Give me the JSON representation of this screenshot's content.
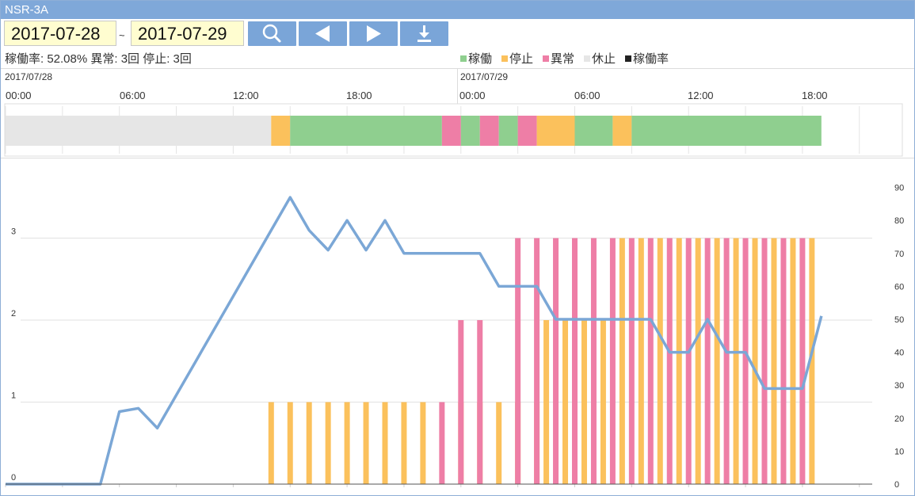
{
  "window": {
    "title": "NSR-3A"
  },
  "toolbar": {
    "start_date": "2017-07-28",
    "separator": "~",
    "end_date": "2017-07-29",
    "buttons": [
      {
        "name": "search-button",
        "icon": "search-icon"
      },
      {
        "name": "prev-button",
        "icon": "triangle-left-icon"
      },
      {
        "name": "next-button",
        "icon": "triangle-right-icon"
      },
      {
        "name": "download-button",
        "icon": "download-icon"
      }
    ]
  },
  "summary": {
    "text": "稼働率: 52.08% 異常: 3回 停止: 3回"
  },
  "legend": [
    {
      "label": "稼働",
      "color": "#8fcf8f"
    },
    {
      "label": "停止",
      "color": "#fbc15c"
    },
    {
      "label": "異常",
      "color": "#ee7ea6"
    },
    {
      "label": "休止",
      "color": "#e6e6e6"
    },
    {
      "label": "稼働率",
      "color": "#222222"
    }
  ],
  "time_axis": {
    "dates": [
      "2017/07/28",
      "2017/07/29"
    ],
    "ticks": [
      "00:00",
      "06:00",
      "12:00",
      "18:00",
      "00:00",
      "06:00",
      "12:00",
      "18:00"
    ]
  },
  "timeline": {
    "segments": [
      {
        "state": "休止",
        "start_hour": 0.0,
        "end_hour": 14.0
      },
      {
        "state": "停止",
        "start_hour": 14.0,
        "end_hour": 15.0
      },
      {
        "state": "稼働",
        "start_hour": 15.0,
        "end_hour": 23.0
      },
      {
        "state": "異常",
        "start_hour": 23.0,
        "end_hour": 24.0
      },
      {
        "state": "稼働",
        "start_hour": 24.0,
        "end_hour": 25.0
      },
      {
        "state": "異常",
        "start_hour": 25.0,
        "end_hour": 26.0
      },
      {
        "state": "稼働",
        "start_hour": 26.0,
        "end_hour": 27.0
      },
      {
        "state": "異常",
        "start_hour": 27.0,
        "end_hour": 28.0
      },
      {
        "state": "停止",
        "start_hour": 28.0,
        "end_hour": 30.0
      },
      {
        "state": "稼働",
        "start_hour": 30.0,
        "end_hour": 32.0
      },
      {
        "state": "停止",
        "start_hour": 32.0,
        "end_hour": 33.0
      },
      {
        "state": "稼働",
        "start_hour": 33.0,
        "end_hour": 43.0
      }
    ]
  },
  "chart_data": {
    "type": "bar",
    "x_unit": "hours since 2017/07/28 00:00",
    "y_left_ticks": [
      "0",
      "1",
      "2",
      "3"
    ],
    "y_right_ticks": [
      "0",
      "10",
      "20",
      "30",
      "40",
      "50",
      "60",
      "70",
      "80",
      "90"
    ],
    "ylim_left": [
      0,
      3.3
    ],
    "ylim_right": [
      0,
      90
    ],
    "grid": true,
    "series": [
      {
        "name": "停止",
        "kind": "bar",
        "color": "#fbc15c",
        "points": [
          [
            14,
            1
          ],
          [
            15,
            1
          ],
          [
            16,
            1
          ],
          [
            17,
            1
          ],
          [
            18,
            1
          ],
          [
            19,
            1
          ],
          [
            20,
            1
          ],
          [
            21,
            1
          ],
          [
            22,
            1
          ],
          [
            24,
            1
          ],
          [
            25,
            1
          ],
          [
            26,
            1
          ],
          [
            27,
            1
          ],
          [
            28,
            1
          ],
          [
            28.5,
            2
          ],
          [
            29.5,
            2
          ],
          [
            30.5,
            2
          ],
          [
            31.5,
            2
          ],
          [
            32.5,
            3
          ],
          [
            33.5,
            3
          ],
          [
            34.5,
            3
          ],
          [
            35.5,
            3
          ],
          [
            36.5,
            3
          ],
          [
            37.5,
            3
          ],
          [
            38.5,
            3
          ],
          [
            39.5,
            3
          ],
          [
            40.5,
            3
          ],
          [
            41.5,
            3
          ],
          [
            42.5,
            3
          ]
        ]
      },
      {
        "name": "異常",
        "kind": "bar",
        "color": "#ee7ea6",
        "points": [
          [
            23,
            1
          ],
          [
            24,
            2
          ],
          [
            25,
            2
          ],
          [
            27,
            3
          ],
          [
            28,
            3
          ],
          [
            29,
            3
          ],
          [
            30,
            3
          ],
          [
            31,
            3
          ],
          [
            32,
            3
          ],
          [
            33,
            3
          ],
          [
            34,
            3
          ],
          [
            35,
            3
          ],
          [
            36,
            3
          ],
          [
            37,
            3
          ],
          [
            38,
            3
          ],
          [
            39,
            3
          ],
          [
            40,
            3
          ],
          [
            41,
            3
          ],
          [
            42,
            3
          ]
        ]
      },
      {
        "name": "稼働率",
        "kind": "line",
        "color": "#7ba7d6",
        "axis": "right",
        "points": [
          [
            0,
            0
          ],
          [
            1,
            0
          ],
          [
            2,
            0
          ],
          [
            3,
            0
          ],
          [
            4,
            0
          ],
          [
            5,
            0
          ],
          [
            6,
            22
          ],
          [
            7,
            23
          ],
          [
            8,
            17
          ],
          [
            9,
            27
          ],
          [
            10,
            37
          ],
          [
            11,
            47
          ],
          [
            12,
            57
          ],
          [
            13,
            67
          ],
          [
            14,
            77
          ],
          [
            15,
            87
          ],
          [
            16,
            77
          ],
          [
            17,
            71
          ],
          [
            18,
            80
          ],
          [
            19,
            71
          ],
          [
            20,
            80
          ],
          [
            21,
            70
          ],
          [
            22,
            70
          ],
          [
            23,
            70
          ],
          [
            24,
            70
          ],
          [
            25,
            70
          ],
          [
            26,
            60
          ],
          [
            27,
            60
          ],
          [
            28,
            60
          ],
          [
            29,
            50
          ],
          [
            30,
            50
          ],
          [
            31,
            50
          ],
          [
            32,
            50
          ],
          [
            33,
            50
          ],
          [
            34,
            50
          ],
          [
            35,
            40
          ],
          [
            36,
            40
          ],
          [
            37,
            50
          ],
          [
            38,
            40
          ],
          [
            39,
            40
          ],
          [
            40,
            29
          ],
          [
            41,
            29
          ],
          [
            42,
            29
          ],
          [
            43,
            51
          ]
        ]
      }
    ]
  },
  "colors": {
    "titlebar": "#7fa8d9",
    "button": "#7aa5d8",
    "稼働": "#8fcf8f",
    "停止": "#fbc15c",
    "異常": "#ee7ea6",
    "休止": "#e6e6e6"
  }
}
